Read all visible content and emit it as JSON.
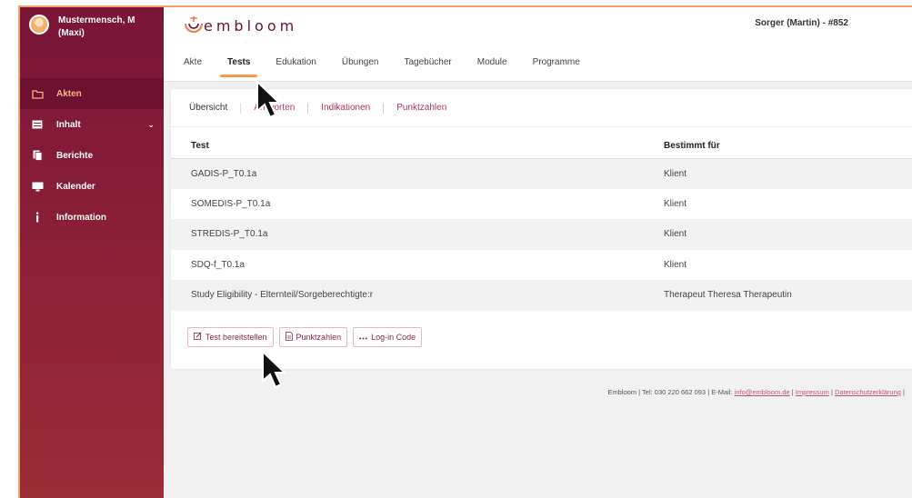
{
  "user": {
    "name_line1": "Mustermensch, M",
    "name_line2": "(Maxi)"
  },
  "sidebar": {
    "items": [
      {
        "label": "Akten",
        "icon": "folder-icon",
        "active": true
      },
      {
        "label": "Inhalt",
        "icon": "content-icon",
        "caret": "⌄"
      },
      {
        "label": "Berichte",
        "icon": "report-icon"
      },
      {
        "label": "Kalender",
        "icon": "monitor-icon"
      },
      {
        "label": "Information",
        "icon": "info-icon"
      }
    ]
  },
  "header": {
    "logo_text": "embloom",
    "patient": "Sorger (Martin) - #852",
    "tabs": [
      "Akte",
      "Tests",
      "Edukation",
      "Übungen",
      "Tagebücher",
      "Module",
      "Programme"
    ],
    "active_tab": "Tests"
  },
  "subtabs": [
    "Übersicht",
    "Antworten",
    "Indikationen",
    "Punktzahlen"
  ],
  "table": {
    "headers": [
      "Test",
      "Bestimmt für"
    ],
    "rows": [
      [
        "GADIS-P_T0.1a",
        "Klient"
      ],
      [
        "SOMEDIS-P_T0.1a",
        "Klient"
      ],
      [
        "STREDIS-P_T0.1a",
        "Klient"
      ],
      [
        "SDQ-f_T0.1a",
        "Klient"
      ],
      [
        "Study Eligibility - Elternteil/Sorgeberechtigte:r",
        "Therapeut Theresa Therapeutin"
      ]
    ]
  },
  "actions": [
    {
      "label": "Test bereitstellen",
      "icon": "edit-icon"
    },
    {
      "label": "Punktzahlen",
      "icon": "document-icon"
    },
    {
      "label": "Log-in Code",
      "icon": "dots-icon"
    }
  ],
  "footer": {
    "prefix": "Embloom | Tel: 030 220 662 093 | E-Mail: ",
    "email": "info@embloom.de",
    "sep1": " | ",
    "impressum": "Impressum",
    "sep2": " | ",
    "privacy": "Datenschutzerklärung",
    "suffix": " |"
  },
  "colors": {
    "sidebar": "#8a1f37",
    "accent": "#f39a4e",
    "link": "#b2325e"
  }
}
